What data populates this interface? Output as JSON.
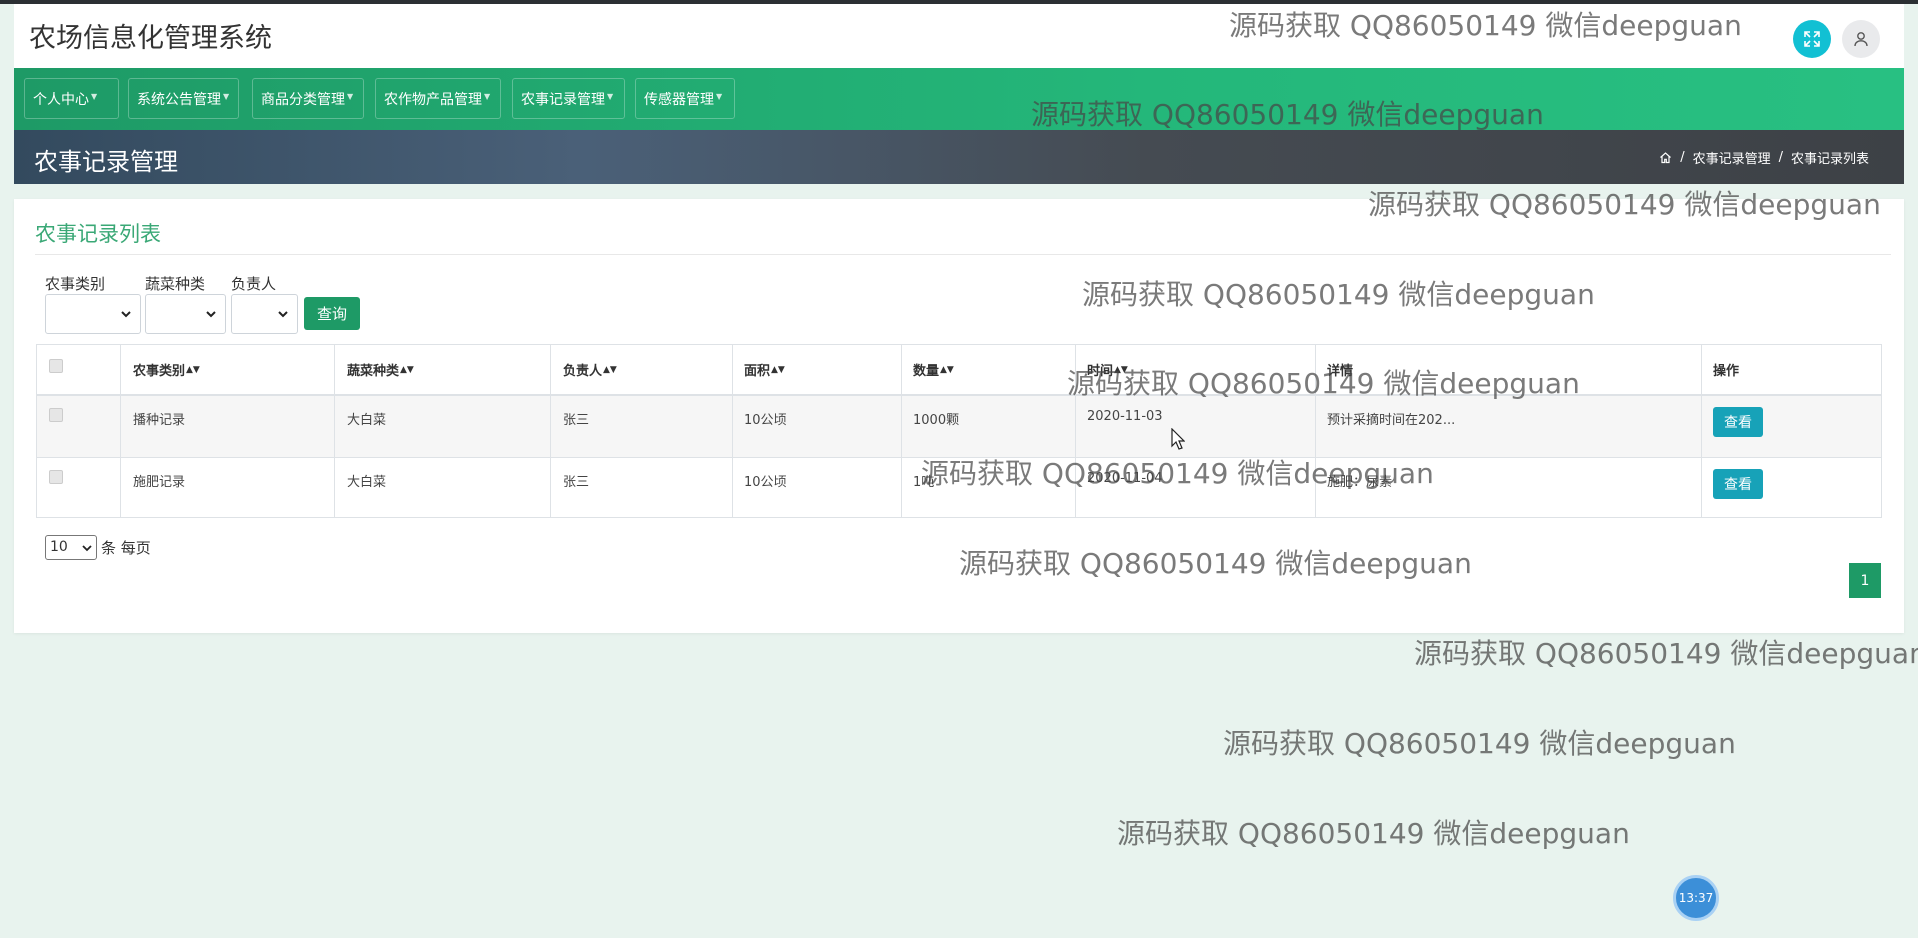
{
  "app": {
    "title": "农场信息化管理系统"
  },
  "nav": {
    "items": [
      {
        "label": "个人中心"
      },
      {
        "label": "系统公告管理"
      },
      {
        "label": "商品分类管理"
      },
      {
        "label": "农作物产品管理"
      },
      {
        "label": "农事记录管理"
      },
      {
        "label": "传感器管理"
      }
    ]
  },
  "page": {
    "title": "农事记录管理",
    "breadcrumb": [
      "农事记录管理",
      "农事记录列表"
    ]
  },
  "card": {
    "title": "农事记录列表"
  },
  "filters": {
    "labels": [
      "农事类别",
      "蔬菜种类",
      "负责人"
    ],
    "query_button": "查询"
  },
  "table": {
    "columns": [
      "农事类别",
      "蔬菜种类",
      "负责人",
      "面积",
      "数量",
      "时间",
      "详情",
      "操作"
    ],
    "rows": [
      {
        "category": "播种记录",
        "vegetable": "大白菜",
        "owner": "张三",
        "area": "10公顷",
        "quantity": "1000颗",
        "time": "2020-11-03",
        "detail": "预计采摘时间在202...",
        "action": "查看"
      },
      {
        "category": "施肥记录",
        "vegetable": "大白菜",
        "owner": "张三",
        "area": "10公顷",
        "quantity": "1吨",
        "time": "2020-11-04",
        "detail": "施肥：尿素",
        "action": "查看"
      }
    ]
  },
  "pagination": {
    "page_size": "10",
    "per_page_label": "条 每页",
    "current_page": "1"
  },
  "watermark": {
    "text": "源码获取 QQ86050149 微信deepguan"
  },
  "clock": {
    "time": "13:37"
  },
  "colors": {
    "primary": "#1e9a66",
    "info": "#17a2b8",
    "title_green": "#3aa876"
  }
}
